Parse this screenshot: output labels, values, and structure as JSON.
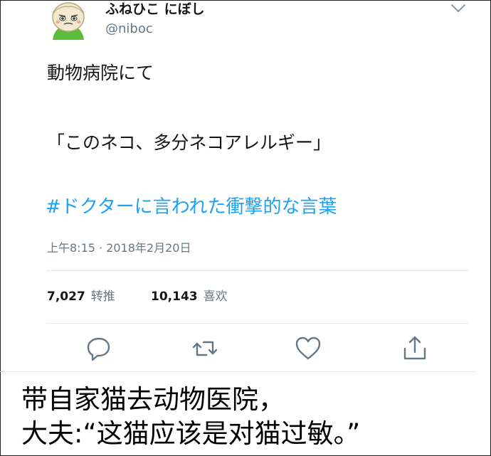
{
  "tweet": {
    "author": {
      "display_name": "ふねひこ にぼし",
      "handle": "@niboc"
    },
    "text_line_1": "動物病院にて",
    "text_line_2": "「このネコ、多分ネコアレルギー」",
    "hashtag": "#ドクターに言われた衝撃的な言葉",
    "timestamp": "上午8:15 · 2018年2月20日",
    "stats": {
      "retweets_count": "7,027",
      "retweets_label": "转推",
      "likes_count": "10,143",
      "likes_label": "喜欢"
    },
    "actions": [
      "reply-icon",
      "retweet-icon",
      "like-icon",
      "share-icon"
    ],
    "colors": {
      "link": "#1da1f2",
      "muted": "#657786",
      "text": "#14171a"
    }
  },
  "caption": {
    "line_1": "带自家猫去动物医院，",
    "line_2": "大夫:“这猫应该是对猫过敏。”"
  }
}
